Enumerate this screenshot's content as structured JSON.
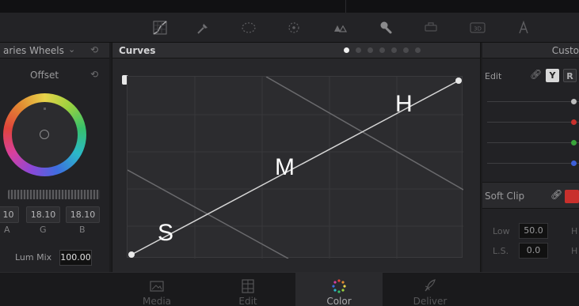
{
  "toolbar": {
    "tools": [
      "curves-icon",
      "eyedropper-icon",
      "window-icon",
      "tracker-icon",
      "magic-mask-icon",
      "blur-icon",
      "key-icon",
      "sizing-icon",
      "3d-icon",
      "motion-effects-icon"
    ],
    "label_3d": "3D"
  },
  "left_panel": {
    "title": "aries Wheels",
    "wheel_label": "Offset",
    "values": [
      "10",
      "18.10",
      "18.10"
    ],
    "value_labels": [
      "A",
      "G",
      "B"
    ],
    "lum_mix_label": "Lum Mix",
    "lum_mix_value": "100.00"
  },
  "curves_panel": {
    "title": "Curves",
    "pager_count": 7,
    "pager_active": 0,
    "overlay_labels": {
      "shadows": "S",
      "midtones": "M",
      "highlights": "H"
    }
  },
  "right_panel": {
    "title": "Custo",
    "edit_label": "Edit",
    "channel_y": "Y",
    "channel_r": "R",
    "channel_colors": [
      "#bdbdbd",
      "#c9302c",
      "#3aa53a",
      "#3d5fd8"
    ],
    "soft_clip_label": "Soft Clip",
    "low_label": "Low",
    "low_value": "50.0",
    "ls_label": "L.S.",
    "ls_value": "0.0",
    "h_label": "H"
  },
  "bottom_nav": {
    "pages": [
      "Media",
      "Edit",
      "Color",
      "Deliver"
    ],
    "active": "Color"
  }
}
